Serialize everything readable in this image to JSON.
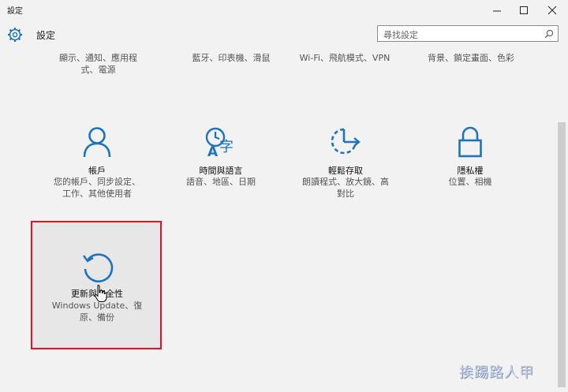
{
  "window": {
    "title": "設定"
  },
  "header": {
    "title": "設定",
    "search_placeholder": "尋找設定"
  },
  "top_row": [
    {
      "line1": "顯示、通知、應用程",
      "line2": "式、電源"
    },
    {
      "line1": "藍牙、印表機、滑鼠",
      "line2": ""
    },
    {
      "line1": "Wi-Fi、飛航模式、VPN",
      "line2": ""
    },
    {
      "line1": "背景、鎖定畫面、色彩",
      "line2": ""
    }
  ],
  "tiles": [
    {
      "name": "帳戶",
      "desc1": "您的帳戶、同步設定、",
      "desc2": "工作、其他使用者",
      "icon": "person-icon"
    },
    {
      "name": "時間與語言",
      "desc1": "語音、地區、日期",
      "desc2": "",
      "icon": "time-language-icon"
    },
    {
      "name": "輕鬆存取",
      "desc1": "朗讀程式、放大鏡、高",
      "desc2": "對比",
      "icon": "ease-of-access-icon"
    },
    {
      "name": "隱私權",
      "desc1": "位置、相機",
      "desc2": "",
      "icon": "lock-icon"
    },
    {
      "name": "更新與安全性",
      "desc1": "Windows Update、復",
      "desc2": "原、備份",
      "icon": "refresh-icon"
    }
  ],
  "watermark": "挨踢路人甲",
  "colors": {
    "accent": "#1e73be",
    "highlight_border": "#e81123"
  }
}
